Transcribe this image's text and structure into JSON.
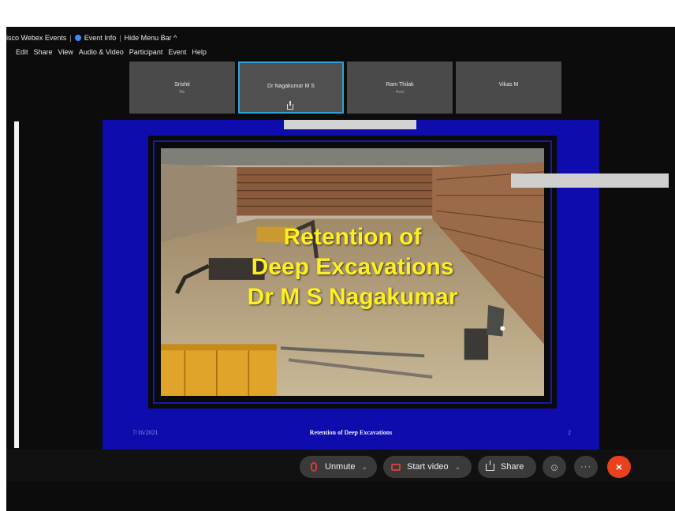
{
  "window": {
    "app_title": "isco Webex Events",
    "event_info_label": "Event Info",
    "hide_menu_label": "Hide Menu Bar",
    "hide_menu_caret": "^"
  },
  "menu": {
    "items": [
      "Edit",
      "Share",
      "View",
      "Audio & Video",
      "Participant",
      "Event",
      "Help"
    ]
  },
  "participants": [
    {
      "name": "Srishti",
      "sub": "Me"
    },
    {
      "name": "Dr Nagakumar M S",
      "sub": ""
    },
    {
      "name": "Ram Thilak",
      "sub": "Host"
    },
    {
      "name": "Vikas M",
      "sub": ""
    }
  ],
  "slide": {
    "title_lines": [
      "Retention of",
      "Deep Excavations",
      "Dr M S Nagakumar"
    ],
    "footer_date": "7/16/2021",
    "footer_title": "Retention of Deep Excavations",
    "footer_page": "2",
    "background_color": "#0f0cae",
    "title_color": "#ffee20"
  },
  "controls": {
    "unmute_label": "Unmute",
    "start_video_label": "Start video",
    "share_label": "Share",
    "more_label": "···",
    "end_label": "×",
    "chevron": "⌄"
  },
  "icons": {
    "mic": "mic-muted-icon",
    "camera": "camera-off-icon",
    "share": "share-icon",
    "reactions": "smile-icon",
    "more": "more-icon",
    "end": "close-icon"
  }
}
